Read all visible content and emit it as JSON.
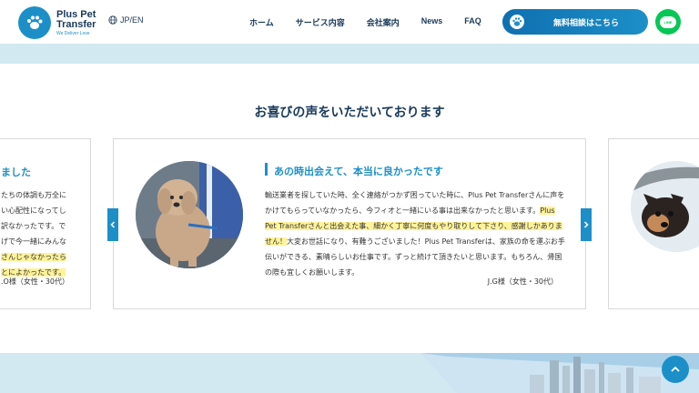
{
  "header": {
    "logo_title_line1": "Plus Pet",
    "logo_title_line2": "Transfer",
    "logo_tagline": "We Deliver Love",
    "lang_label": "JP/EN",
    "nav": [
      "ホーム",
      "サービス内容",
      "会社案内",
      "News",
      "FAQ"
    ],
    "consult_label": "無料相談はこちら",
    "line_label": "LINE"
  },
  "section": {
    "title": "お喜びの声をいただいております"
  },
  "testimonials": {
    "left": {
      "title": "ました",
      "lines": [
        "たちの体調も万全に",
        "い心配性になってし",
        "訳なかったです。で",
        "げで今一緒にみんな",
        "さんじゃなかったら",
        "とによかったです。"
      ],
      "author": ".O様（女性・30代）"
    },
    "center": {
      "title": "あの時出会えて、本当に良かったです",
      "body_part1": "輸送業者を探していた時、全く連絡がつかず困っていた時に、Plus Pet Transferさんに声をかけてもらっていなかったら、今フィオと一緒にいる事は出来なかったと思います。",
      "body_highlight": "Plus Pet Transferさんと出会えた事、細かく丁寧に何度もやり取りして下さり、感謝しかありません！",
      "body_part2": "大変お世話になり、有難うございました！Plus Pet Transferは、家族の命を運ぶお手伝いができる、素晴らしいお仕事です。ずっと続けて頂きたいと思います。もちろん、帰国の際も宜しくお願いします。",
      "author": "J.G様（女性・30代）"
    }
  },
  "colors": {
    "accent": "#1d8fc8",
    "navy": "#1a3a5a",
    "band": "#d2e9f1",
    "highlight": "#fff39a",
    "line_green": "#06c755"
  }
}
